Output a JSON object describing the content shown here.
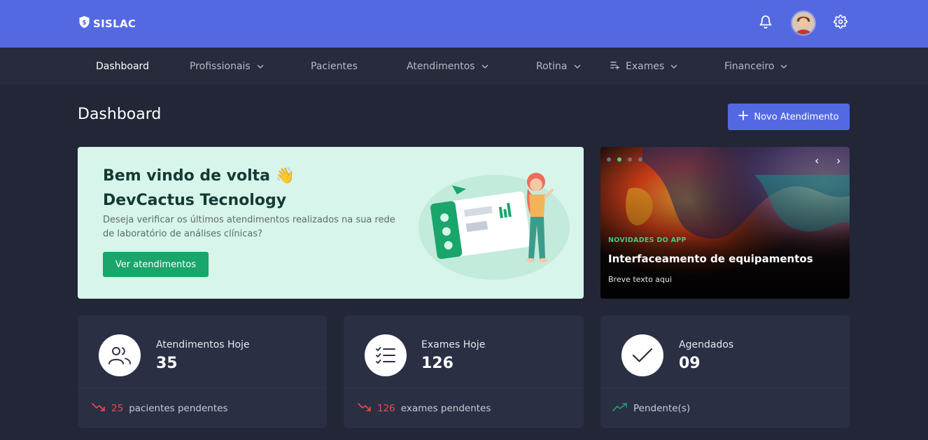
{
  "app": {
    "name": "SISLAC"
  },
  "nav": {
    "items": [
      {
        "label": "Dashboard"
      },
      {
        "label": "Profissionais"
      },
      {
        "label": "Pacientes"
      },
      {
        "label": "Atendimentos"
      },
      {
        "label": "Rotina"
      },
      {
        "label": "Exames"
      },
      {
        "label": "Financeiro"
      }
    ]
  },
  "page": {
    "title": "Dashboard",
    "primary_button": "Novo Atendimento"
  },
  "welcome": {
    "title": "Bem vindo de volta 👋",
    "company": "DevCactus Tecnology",
    "text": "Deseja verificar os últimos atendimentos realizados na sua rede de laboratório de análises clínicas?",
    "button": "Ver atendimentos"
  },
  "promo": {
    "tag": "NOVIDADES DO APP",
    "title": "Interfaceamento de equipamentos",
    "text": "Breve texto aqui"
  },
  "stats": [
    {
      "label": "Atendimentos Hoje",
      "value": "35",
      "foot_number": "25",
      "foot_text": "pacientes pendentes",
      "trend": "down"
    },
    {
      "label": "Exames Hoje",
      "value": "126",
      "foot_number": "126",
      "foot_text": "exames pendentes",
      "trend": "down"
    },
    {
      "label": "Agendados",
      "value": "09",
      "foot_number": "",
      "foot_text": "Pendente(s)",
      "trend": "up"
    }
  ],
  "colors": {
    "topbar": "#5469e1",
    "navbar": "#272b3b",
    "background": "#222636",
    "welcome_card": "#d7f5ea",
    "success": "#1aa56a",
    "danger": "#ee4b4b"
  }
}
